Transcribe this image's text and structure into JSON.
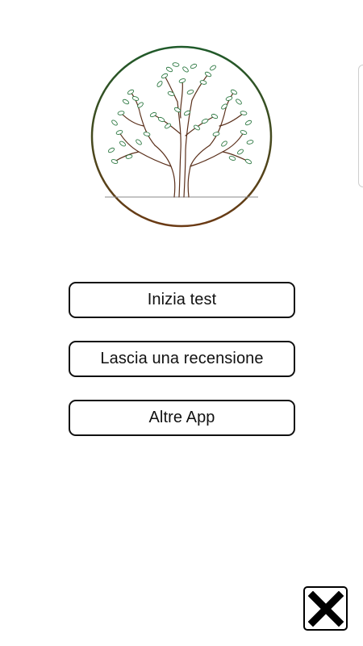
{
  "menu": {
    "start_test_label": "Inizia test",
    "leave_review_label": "Lascia una recensione",
    "other_apps_label": "Altre App"
  },
  "icons": {
    "logo": "tree-logo-icon",
    "close": "close-icon"
  },
  "colors": {
    "background": "#ffffff",
    "logo_ring_top": "#1f5a2a",
    "logo_ring_bottom": "#6b3a14",
    "leaf_green": "#2f7a44",
    "branch_brown": "#5a2f1a",
    "button_border": "#111111"
  }
}
